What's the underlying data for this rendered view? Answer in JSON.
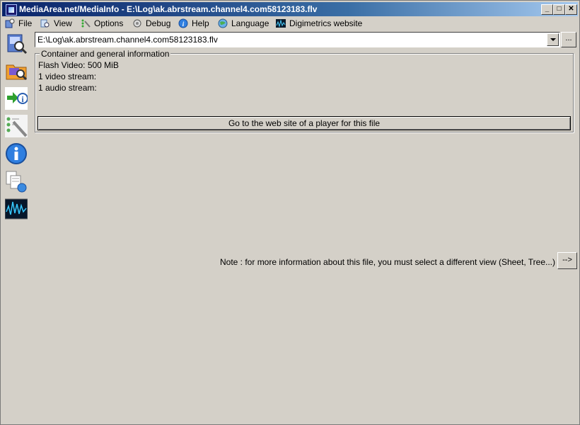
{
  "window": {
    "title": "MediaArea.net/MediaInfo - E:\\Log\\ak.abrstream.channel4.com58123183.flv",
    "controls": {
      "minimize": "_",
      "maximize": "□",
      "close": "✕"
    }
  },
  "menu": {
    "items": [
      {
        "label": "File",
        "icon": "file-menu-icon"
      },
      {
        "label": "View",
        "icon": "view-menu-icon"
      },
      {
        "label": "Options",
        "icon": "options-menu-icon"
      },
      {
        "label": "Debug",
        "icon": "debug-menu-icon"
      },
      {
        "label": "Help",
        "icon": "help-menu-icon"
      },
      {
        "label": "Language",
        "icon": "language-menu-icon"
      },
      {
        "label": "Digimetrics website",
        "icon": "digimetrics-menu-icon"
      }
    ]
  },
  "sidebar": {
    "buttons": [
      {
        "icon": "open-file-icon"
      },
      {
        "icon": "open-folder-icon"
      },
      {
        "icon": "export-icon"
      },
      {
        "icon": "preferences-icon"
      },
      {
        "icon": "about-info-icon"
      },
      {
        "icon": "web-documents-icon"
      },
      {
        "icon": "waveform-icon"
      }
    ]
  },
  "file_selector": {
    "value": "E:\\Log\\ak.abrstream.channel4.com58123183.flv",
    "browse_label": "..."
  },
  "info_group": {
    "legend": "Container and general information",
    "lines": [
      "Flash Video: 500 MiB",
      "1 video stream:",
      "1 audio stream:"
    ],
    "player_button": "Go to the web site of a player for this file"
  },
  "note": {
    "text": "Note : for more information about this file, you must select a different view (Sheet, Tree...)",
    "button": "-->"
  }
}
